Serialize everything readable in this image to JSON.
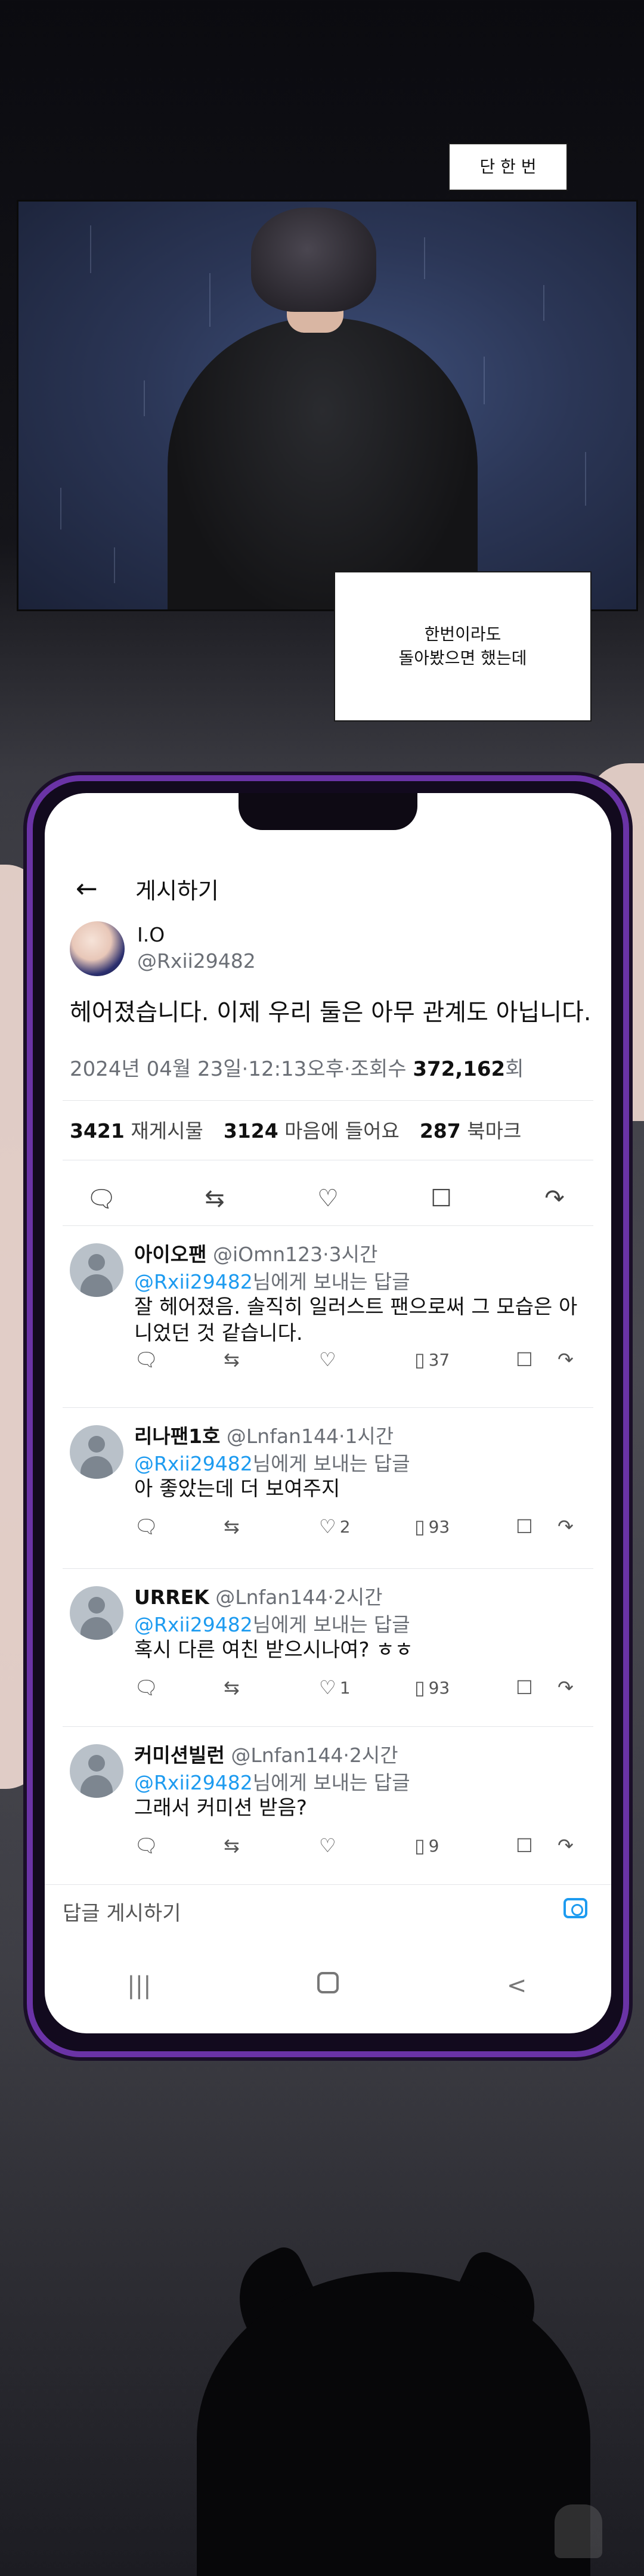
{
  "captions": {
    "top": "단 한 번",
    "middle_line1": "한번이라도",
    "middle_line2": "돌아봤으면 했는데"
  },
  "phone": {
    "topbar": {
      "title": "게시하기",
      "back_icon": "back-arrow-icon"
    },
    "post": {
      "author_name": "I.O",
      "author_handle": "@Rxii29482",
      "text": "헤어졌습니다. 이제 우리 둘은 아무 관계도 아닙니다.",
      "meta_prefix": "2024년 04월 23일·12:13오후·조회수 ",
      "views": "372,162",
      "meta_suffix": "회",
      "stats": {
        "reposts": "3421",
        "reposts_label": "재게시물",
        "likes": "3124",
        "likes_label": "마음에 들어요",
        "bookmarks": "287",
        "bookmarks_label": "북마크"
      }
    },
    "reply_prefix": "@Rxii29482",
    "reply_suffix": "님에게 보내는 답글",
    "replies": [
      {
        "name": "아이오팬",
        "meta": "@iOmn123·3시간",
        "body": "잘 헤어졌음. 솔직히 일러스트 팬으로써 그 모습은 아니었던 것 같습니다.",
        "likes": "",
        "views": "37"
      },
      {
        "name": "리나팬1호",
        "meta": "@Lnfan144·1시간",
        "body": "아 좋았는데 더 보여주지",
        "likes": "2",
        "views": "93"
      },
      {
        "name": "URREK",
        "meta": "@Lnfan144·2시간",
        "body": "혹시 다른 여친 받으시나여? ㅎㅎ",
        "likes": "1",
        "views": "93"
      },
      {
        "name": "커미션빌런",
        "meta": "@Lnfan144·2시간",
        "body": "그래서 커미션 받음?",
        "likes": "",
        "views": "9"
      }
    ],
    "compose_placeholder": "답글 게시하기",
    "navbar": {
      "recent": "|||",
      "back": "<"
    }
  },
  "colors": {
    "accent_blue": "#1d9bf0",
    "phone_frame": "#6a33a6"
  }
}
